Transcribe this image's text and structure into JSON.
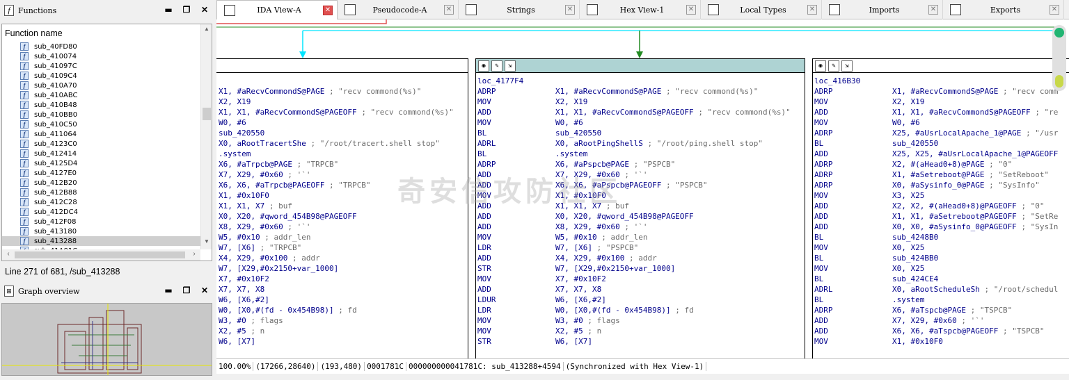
{
  "functions_panel": {
    "title": "Functions",
    "header": "Function name",
    "items": [
      "sub_40FD80",
      "sub_410074",
      "sub_41097C",
      "sub_4109C4",
      "sub_410A70",
      "sub_410ABC",
      "sub_410B48",
      "sub_410BB0",
      "sub_410C50",
      "sub_411064",
      "sub_4123C0",
      "sub_412414",
      "sub_4125D4",
      "sub_4127E0",
      "sub_412B20",
      "sub_412B88",
      "sub_412C28",
      "sub_412DC4",
      "sub_412F08",
      "sub_413180",
      "sub_413288",
      "sub_41A81C"
    ],
    "selected": "sub_413288",
    "status": "Line 271 of 681, /sub_413288"
  },
  "graph_overview": {
    "title": "Graph overview"
  },
  "tabs": [
    {
      "label": "IDA View-A",
      "active": true
    },
    {
      "label": "Pseudocode-A",
      "active": false
    },
    {
      "label": "Strings",
      "active": false
    },
    {
      "label": "Hex View-1",
      "active": false
    },
    {
      "label": "Local Types",
      "active": false
    },
    {
      "label": "Imports",
      "active": false
    },
    {
      "label": "Exports",
      "active": false
    }
  ],
  "nodes": [
    {
      "label": "",
      "lines": [
        [
          "",
          "X1, #aRecvCommondS@PAGE",
          "; \"recv commond(%s)\""
        ],
        [
          "",
          "X2, X19",
          ""
        ],
        [
          "",
          "X1, X1, #aRecvCommondS@PAGEOFF",
          "; \"recv commond(%s)\""
        ],
        [
          "",
          "W0, #6",
          ""
        ],
        [
          "",
          "sub_420550",
          ""
        ],
        [
          "",
          "X0, aRootTracertShe",
          "; \"/root/tracert.shell stop\""
        ],
        [
          "",
          ".system",
          ""
        ],
        [
          "",
          "X6, #aTrpcb@PAGE",
          "; \"TRPCB\""
        ],
        [
          "",
          "X7, X29, #0x60",
          "; '`'"
        ],
        [
          "",
          "X6, X6, #aTrpcb@PAGEOFF",
          "; \"TRPCB\""
        ],
        [
          "",
          "X1, #0x10F0",
          ""
        ],
        [
          "",
          "X1, X1, X7",
          "; buf"
        ],
        [
          "",
          "X0, X20, #qword_454B98@PAGEOFF",
          ""
        ],
        [
          "",
          "X8, X29, #0x60",
          "; '`'"
        ],
        [
          "",
          "W5, #0x10",
          "; addr_len"
        ],
        [
          "",
          "W7, [X6]",
          "; \"TRPCB\""
        ],
        [
          "",
          "X4, X29, #0x100",
          "; addr"
        ],
        [
          "",
          "W7, [X29,#0x2150+var_1000]",
          ""
        ],
        [
          "",
          "X7, #0x10F2",
          ""
        ],
        [
          "",
          "X7, X7, X8",
          ""
        ],
        [
          "",
          "W6, [X6,#2]",
          ""
        ],
        [
          "",
          "W0, [X0,#(fd - 0x454B98)]",
          "; fd"
        ],
        [
          "",
          "W3, #0",
          "; flags"
        ],
        [
          "",
          "X2, #5",
          "; n"
        ],
        [
          "",
          "W6, [X7]",
          ""
        ]
      ]
    },
    {
      "label": "loc_4177F4",
      "lines": [
        [
          "ADRP",
          "X1, #aRecvCommondS@PAGE",
          "; \"recv commond(%s)\""
        ],
        [
          "MOV",
          "X2, X19",
          ""
        ],
        [
          "ADD",
          "X1, X1, #aRecvCommondS@PAGEOFF",
          "; \"recv commond(%s)\""
        ],
        [
          "MOV",
          "W0, #6",
          ""
        ],
        [
          "BL",
          "sub_420550",
          ""
        ],
        [
          "ADRL",
          "X0, aRootPingShellS",
          "; \"/root/ping.shell stop\""
        ],
        [
          "BL",
          ".system",
          ""
        ],
        [
          "ADRP",
          "X6, #aPspcb@PAGE",
          "; \"PSPCB\""
        ],
        [
          "ADD",
          "X7, X29, #0x60",
          "; '`'"
        ],
        [
          "ADD",
          "X6, X6, #aPspcb@PAGEOFF",
          "; \"PSPCB\""
        ],
        [
          "MOV",
          "X1, #0x10F0",
          ""
        ],
        [
          "ADD",
          "X1, X1, X7",
          "; buf"
        ],
        [
          "ADD",
          "X0, X20, #qword_454B98@PAGEOFF",
          ""
        ],
        [
          "ADD",
          "X8, X29, #0x60",
          "; '`'"
        ],
        [
          "MOV",
          "W5, #0x10",
          "; addr_len"
        ],
        [
          "LDR",
          "W7, [X6]",
          "; \"PSPCB\""
        ],
        [
          "ADD",
          "X4, X29, #0x100",
          "; addr"
        ],
        [
          "STR",
          "W7, [X29,#0x2150+var_1000]",
          ""
        ],
        [
          "MOV",
          "X7, #0x10F2",
          ""
        ],
        [
          "ADD",
          "X7, X7, X8",
          ""
        ],
        [
          "LDUR",
          "W6, [X6,#2]",
          ""
        ],
        [
          "LDR",
          "W0, [X0,#(fd - 0x454B98)]",
          "; fd"
        ],
        [
          "MOV",
          "W3, #0",
          "; flags"
        ],
        [
          "MOV",
          "X2, #5",
          "; n"
        ],
        [
          "STR",
          "W6, [X7]",
          ""
        ]
      ]
    },
    {
      "label": "loc_416B30",
      "lines": [
        [
          "ADRP",
          "X1, #aRecvCommondS@PAGE",
          "; \"recv comm"
        ],
        [
          "MOV",
          "X2, X19",
          ""
        ],
        [
          "ADD",
          "X1, X1, #aRecvCommondS@PAGEOFF",
          "; \"re"
        ],
        [
          "MOV",
          "W0, #6",
          ""
        ],
        [
          "ADRP",
          "X25, #aUsrLocalApache_1@PAGE",
          "; \"/usr"
        ],
        [
          "BL",
          "sub_420550",
          ""
        ],
        [
          "ADD",
          "X25, X25, #aUsrLocalApache_1@PAGEOFF",
          ""
        ],
        [
          "ADRP",
          "X2, #(aHead0+8)@PAGE",
          "; \"0\""
        ],
        [
          "ADRP",
          "X1, #aSetreboot@PAGE",
          "; \"SetReboot\""
        ],
        [
          "ADRP",
          "X0, #aSysinfo_0@PAGE",
          "; \"SysInfo\""
        ],
        [
          "MOV",
          "X3, X25",
          ""
        ],
        [
          "ADD",
          "X2, X2, #(aHead0+8)@PAGEOFF",
          "; \"0\""
        ],
        [
          "ADD",
          "X1, X1, #aSetreboot@PAGEOFF",
          "; \"SetRe"
        ],
        [
          "ADD",
          "X0, X0, #aSysinfo_0@PAGEOFF",
          "; \"SysIn"
        ],
        [
          "BL",
          "sub_4248B0",
          ""
        ],
        [
          "MOV",
          "X0, X25",
          ""
        ],
        [
          "BL",
          "sub_424BB0",
          ""
        ],
        [
          "MOV",
          "X0, X25",
          ""
        ],
        [
          "BL",
          "sub_424CE4",
          ""
        ],
        [
          "ADRL",
          "X0, aRootScheduleSh",
          "; \"/root/schedul"
        ],
        [
          "BL",
          ".system",
          ""
        ],
        [
          "ADRP",
          "X6, #aTspcb@PAGE",
          "; \"TSPCB\""
        ],
        [
          "ADD",
          "X7, X29, #0x60",
          "; '`'"
        ],
        [
          "ADD",
          "X6, X6, #aTspcb@PAGEOFF",
          "; \"TSPCB\""
        ],
        [
          "MOV",
          "X1, #0x10F0",
          ""
        ]
      ]
    }
  ],
  "statusbar": [
    "100.00%",
    "(17266,28640)",
    "(193,480)",
    "0001781C",
    "000000000041781C: sub_413288+4594",
    "(Synchronized with Hex View-1)"
  ],
  "watermark": "奇安信攻防社区",
  "colors": {
    "node_header": "#aed3d3",
    "code": "#00008b",
    "comment": "#6b6b6b",
    "edge_green": "#228b22",
    "edge_cyan": "#00e5ff",
    "edge_red": "#e05050"
  }
}
